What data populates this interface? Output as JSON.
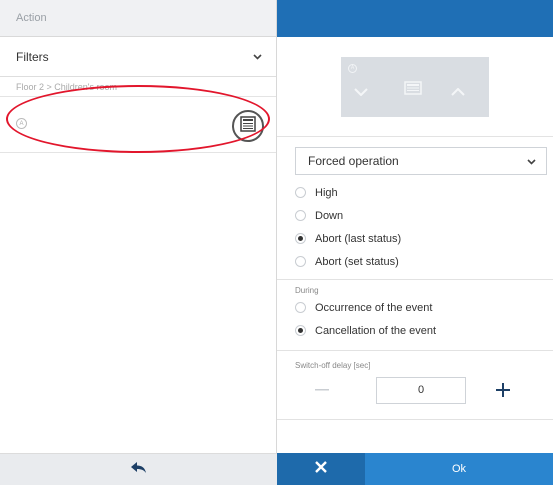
{
  "left": {
    "header_title": "Action",
    "filters_label": "Filters",
    "breadcrumb": "Floor 2 > Children's room",
    "device_badge": "A"
  },
  "right": {
    "preview_badge": "A",
    "mode_select": "Forced operation",
    "mode_options": [
      {
        "label": "High",
        "selected": false
      },
      {
        "label": "Down",
        "selected": false
      },
      {
        "label": "Abort (last status)",
        "selected": true
      },
      {
        "label": "Abort (set status)",
        "selected": false
      }
    ],
    "during_label": "During",
    "during_options": [
      {
        "label": "Occurrence of the event",
        "selected": false
      },
      {
        "label": "Cancellation of the event",
        "selected": true
      }
    ],
    "delay_label": "Switch-off delay [sec]",
    "delay_value": "0",
    "ok_label": "Ok"
  },
  "colors": {
    "accent_blue": "#1f6fb5",
    "ok_blue": "#2a85cf",
    "highlight_red": "#e2162c"
  },
  "icons": [
    "chevron-down-icon",
    "shutter-icon",
    "back-arrow-icon",
    "close-icon",
    "plus-icon",
    "minus-icon",
    "arrow-up-icon",
    "arrow-down-icon",
    "stop-icon"
  ]
}
